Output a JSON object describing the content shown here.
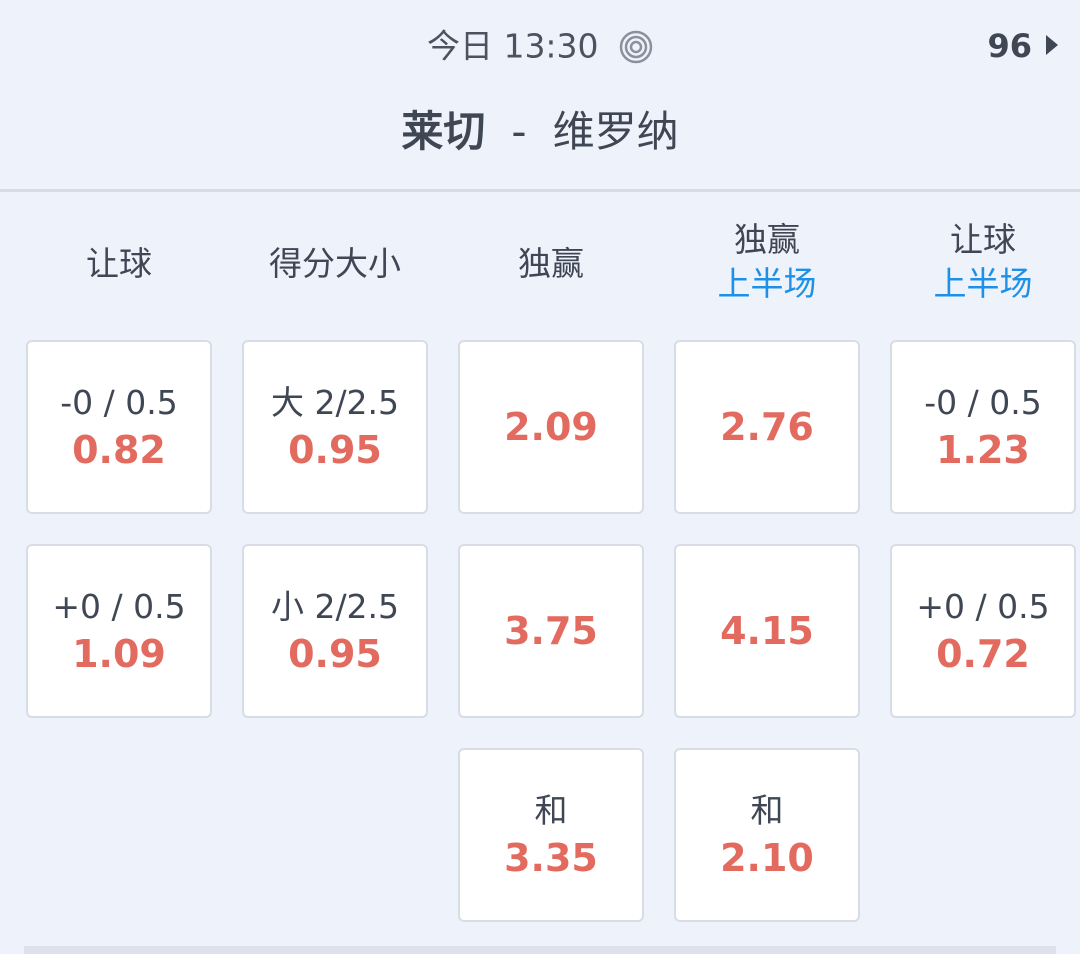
{
  "header": {
    "time": "今日 13:30",
    "live_icon": "live-stream-icon",
    "more_count": "96",
    "more_icon": "chevron-right-icon",
    "home_team": "莱切",
    "separator": "-",
    "away_team": "维罗纳"
  },
  "columns": [
    {
      "title": "让球",
      "sub": ""
    },
    {
      "title": "得分大小",
      "sub": ""
    },
    {
      "title": "独赢",
      "sub": ""
    },
    {
      "title": "独赢",
      "sub": "上半场"
    },
    {
      "title": "让球",
      "sub": "上半场"
    }
  ],
  "rows": [
    [
      {
        "line": "-0 / 0.5",
        "odd": "0.82"
      },
      {
        "line": "大 2/2.5",
        "odd": "0.95"
      },
      {
        "line": "",
        "odd": "2.09"
      },
      {
        "line": "",
        "odd": "2.76"
      },
      {
        "line": "-0 / 0.5",
        "odd": "1.23"
      }
    ],
    [
      {
        "line": "+0 / 0.5",
        "odd": "1.09"
      },
      {
        "line": "小 2/2.5",
        "odd": "0.95"
      },
      {
        "line": "",
        "odd": "3.75"
      },
      {
        "line": "",
        "odd": "4.15"
      },
      {
        "line": "+0 / 0.5",
        "odd": "0.72"
      }
    ],
    [
      null,
      null,
      {
        "line": "和",
        "odd": "3.35"
      },
      {
        "line": "和",
        "odd": "2.10"
      },
      null
    ]
  ],
  "colors": {
    "odds": "#e26a5f",
    "sub_header": "#1e90e6",
    "background": "#eef3fb"
  }
}
